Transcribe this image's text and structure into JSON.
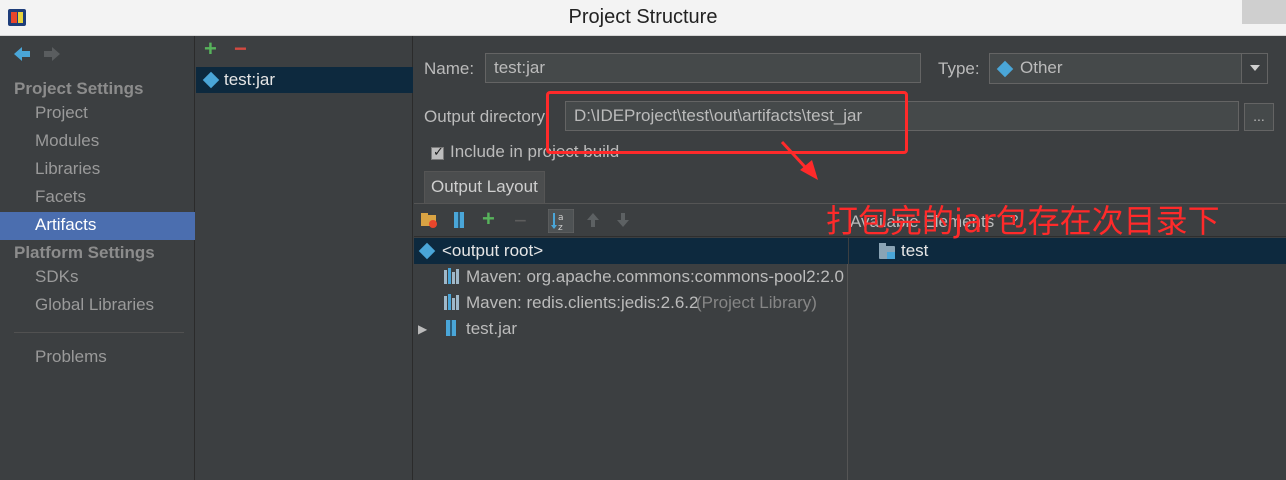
{
  "window": {
    "title": "Project Structure",
    "app_icon": "intellij-icon"
  },
  "nav": {
    "back_icon": "back-arrow-icon",
    "forward_icon": "forward-arrow-icon",
    "project_settings_header": "Project Settings",
    "project_settings_items": [
      "Project",
      "Modules",
      "Libraries",
      "Facets",
      "Artifacts"
    ],
    "platform_settings_header": "Platform Settings",
    "platform_settings_items": [
      "SDKs",
      "Global Libraries"
    ],
    "problems": "Problems",
    "selected": "Artifacts"
  },
  "artifacts": {
    "add_icon": "plus-icon",
    "remove_icon": "minus-icon",
    "items": [
      "test:jar"
    ]
  },
  "details": {
    "name_label": "Name:",
    "name_value": "test:jar",
    "type_label": "Type:",
    "type_value": "Other",
    "output_dir_label": "Output directory:",
    "output_dir_value": "D:\\IDEProject\\test\\out\\artifacts\\test_jar",
    "browse_label": "...",
    "include_in_build_label": "Include in project build",
    "include_in_build_checked": true,
    "tab_output_layout": "Output Layout",
    "toolbar_icons": [
      "create-directory-icon",
      "archive-icon",
      "plus-icon",
      "minus-icon",
      "sort-icon",
      "move-up-icon",
      "move-down-icon"
    ],
    "available_elements_label": "Available Elements",
    "available_elements_help": "?",
    "tree": [
      {
        "label": "<output root>",
        "suffix": "",
        "icon": "artifact-icon"
      },
      {
        "label": "Maven: org.apache.commons:commons-pool2:2.0",
        "suffix": "",
        "icon": "library-icon"
      },
      {
        "label": "Maven: redis.clients:jedis:2.6.2",
        "suffix": "(Project Library)",
        "icon": "library-icon"
      },
      {
        "label": "test.jar",
        "suffix": "",
        "icon": "jar-icon"
      }
    ],
    "available": [
      {
        "label": "test",
        "icon": "module-folder-icon"
      }
    ]
  },
  "annotation": {
    "text": "打包完的jar包存在次目录下",
    "color": "#ff2a2a"
  },
  "colors": {
    "background": "#3c3f41",
    "selection": "#4b6eaf",
    "tree_selection": "#0d293e",
    "accent_blue": "#4aa6d8"
  }
}
